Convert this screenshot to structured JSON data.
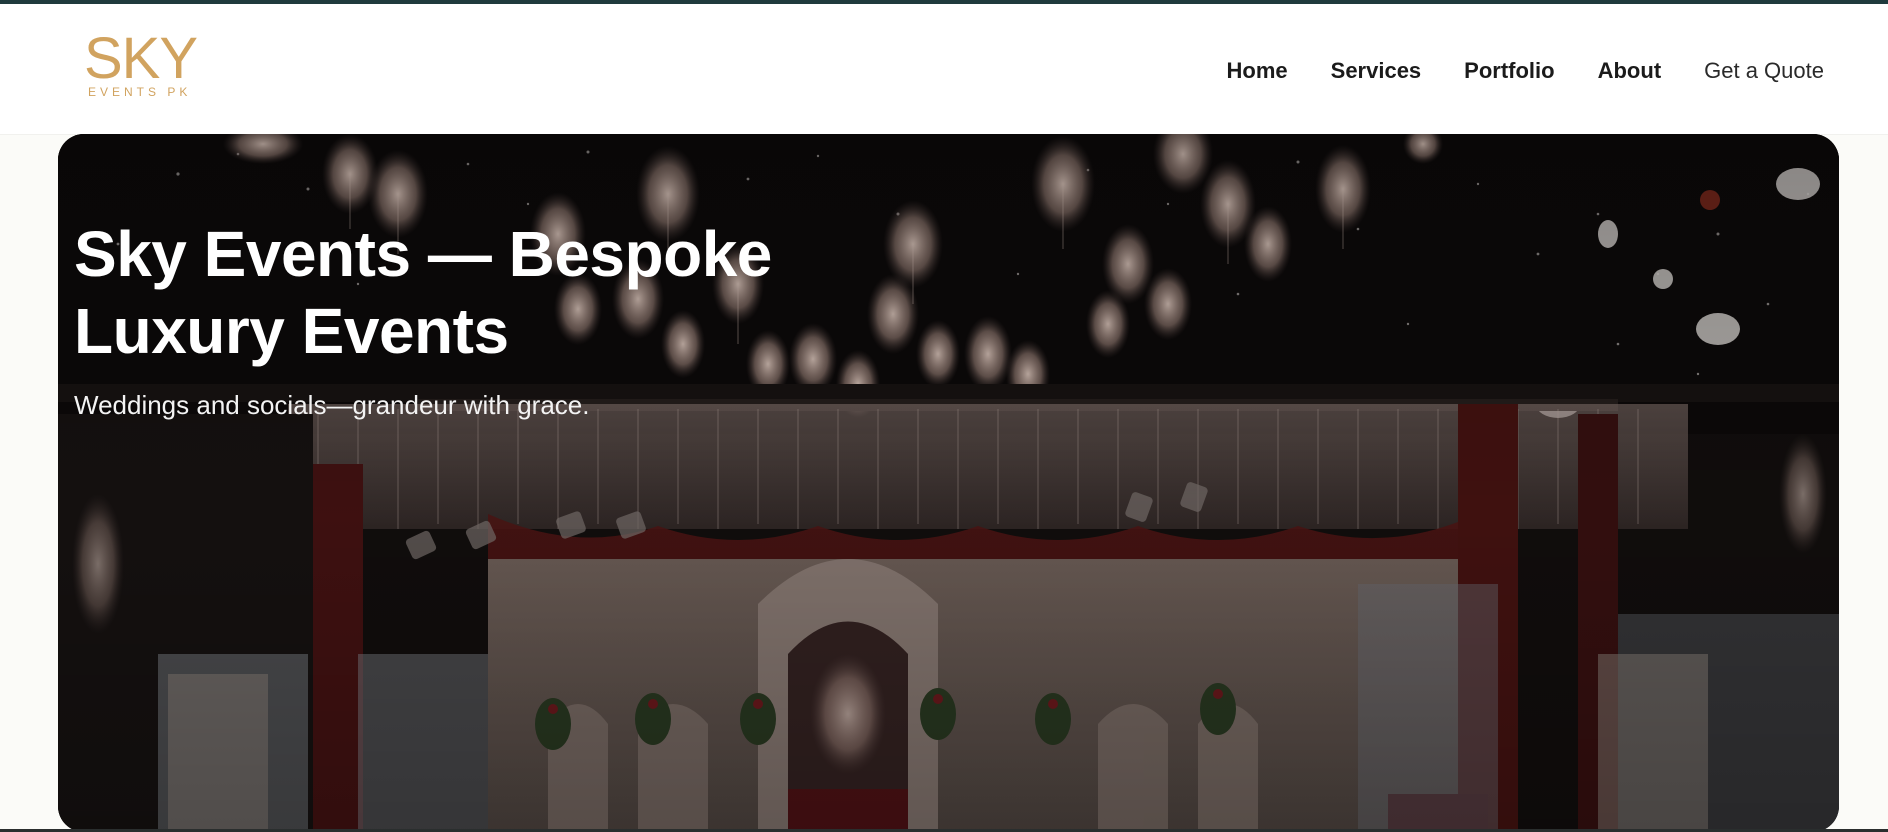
{
  "brand": {
    "logo_main": "SKY",
    "logo_sub": "EVENTS PK",
    "logo_color": "#d1a35f",
    "accent_strip_color": "#1f3a3d"
  },
  "nav": {
    "items": [
      {
        "label": "Home"
      },
      {
        "label": "Services"
      },
      {
        "label": "Portfolio"
      },
      {
        "label": "About"
      },
      {
        "label": "Get a Quote"
      }
    ]
  },
  "hero": {
    "title_line1": "Sky Events — Bespoke",
    "title_line2": "Luxury Events",
    "subtitle": "Weddings and socials—grandeur with grace."
  }
}
